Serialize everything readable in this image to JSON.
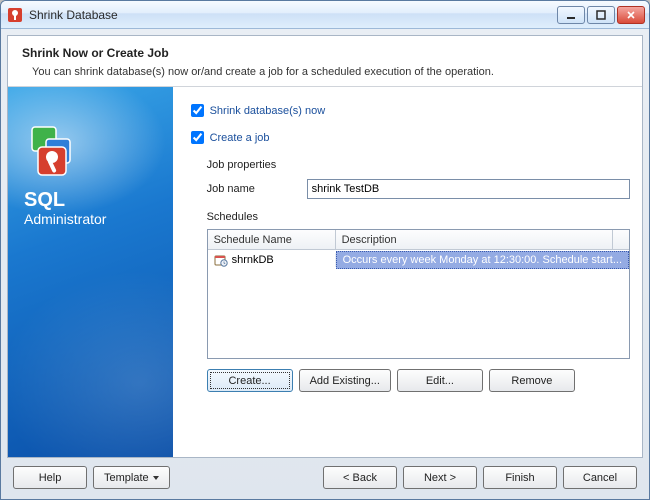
{
  "window": {
    "title": "Shrink Database"
  },
  "header": {
    "title": "Shrink Now or Create Job",
    "description": "You can shrink database(s) now or/and create a job for a scheduled execution of the operation."
  },
  "sidebar": {
    "app_name": "SQL",
    "app_sub": "Administrator"
  },
  "options": {
    "shrink_now_label": "Shrink database(s) now",
    "shrink_now_checked": true,
    "create_job_label": "Create a job",
    "create_job_checked": true
  },
  "job": {
    "properties_label": "Job properties",
    "name_label": "Job name",
    "name_value": "shrink TestDB"
  },
  "schedules": {
    "label": "Schedules",
    "columns": {
      "name": "Schedule Name",
      "description": "Description"
    },
    "rows": [
      {
        "name": "shrnkDB",
        "description": "Occurs every week Monday at 12:30:00. Schedule start...",
        "selected": true
      }
    ],
    "buttons": {
      "create": "Create...",
      "add_existing": "Add Existing...",
      "edit": "Edit...",
      "remove": "Remove"
    }
  },
  "footer": {
    "help": "Help",
    "template": "Template",
    "back": "< Back",
    "next": "Next >",
    "finish": "Finish",
    "cancel": "Cancel"
  }
}
